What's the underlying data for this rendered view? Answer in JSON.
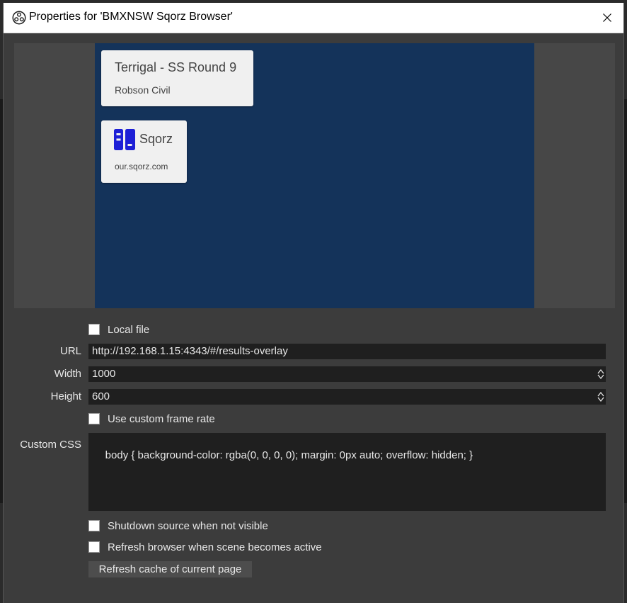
{
  "window": {
    "title": "Properties for 'BMXNSW Sqorz Browser'",
    "close_glyph": "✕",
    "app_icon": "obs-logo-icon"
  },
  "preview": {
    "event_card": {
      "title": "Terrigal - SS Round 9",
      "subtitle": "Robson Civil"
    },
    "brand_card": {
      "name": "Sqorz",
      "url": "our.sqorz.com",
      "logo_color": "#1d1fd6"
    },
    "background_color": "#14335a"
  },
  "form": {
    "local_file": {
      "label": "Local file",
      "checked": false
    },
    "url": {
      "label": "URL",
      "value": "http://192.168.1.15:4343/#/results-overlay"
    },
    "width": {
      "label": "Width",
      "value": "1000"
    },
    "height": {
      "label": "Height",
      "value": "600"
    },
    "custom_frame_rate": {
      "label": "Use custom frame rate",
      "checked": false
    },
    "custom_css": {
      "label": "Custom CSS",
      "value": "body { background-color: rgba(0, 0, 0, 0); margin: 0px auto; overflow: hidden; }"
    },
    "shutdown_source": {
      "label": "Shutdown source when not visible",
      "checked": false
    },
    "refresh_browser": {
      "label": "Refresh browser when scene becomes active",
      "checked": false
    },
    "refresh_cache_button": "Refresh cache of current page"
  },
  "spin": {
    "up": "▲",
    "down": "▼"
  }
}
